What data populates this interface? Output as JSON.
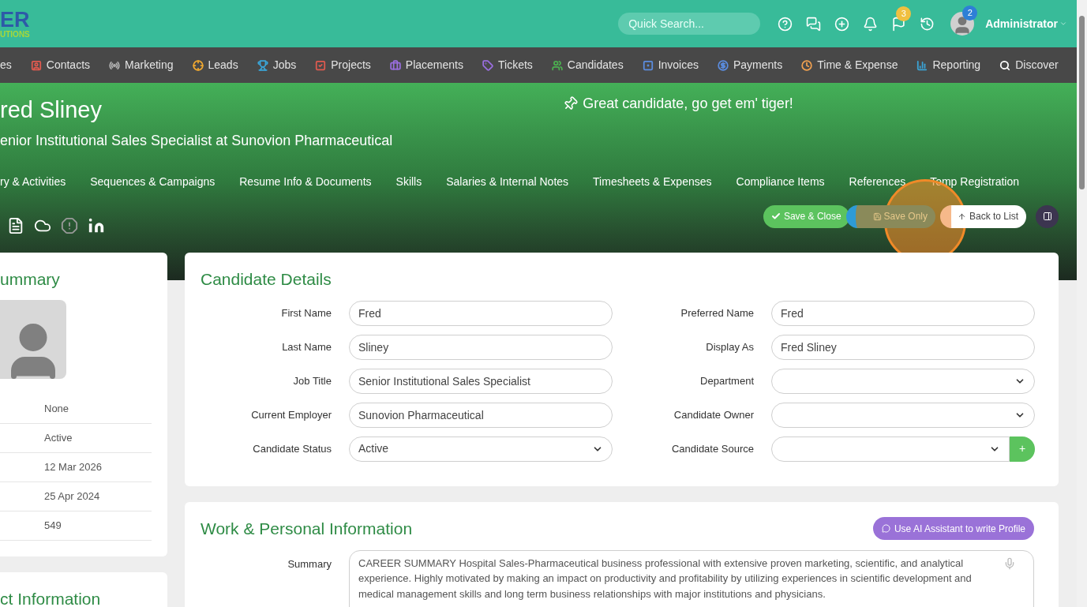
{
  "logo": {
    "text": "ER",
    "subtext": "UTIONS"
  },
  "search": {
    "placeholder": "Quick Search..."
  },
  "header": {
    "flag_badge": "3",
    "avatar_badge": "2",
    "user": "Administrator"
  },
  "nav": [
    {
      "label": "es"
    },
    {
      "label": "Contacts",
      "color": "#e05a4f"
    },
    {
      "label": "Marketing",
      "color": "#b0b0b0"
    },
    {
      "label": "Leads",
      "color": "#f0a830"
    },
    {
      "label": "Jobs",
      "color": "#3aa5d8"
    },
    {
      "label": "Projects",
      "color": "#e05a4f"
    },
    {
      "label": "Placements",
      "color": "#9a6ee0"
    },
    {
      "label": "Tickets",
      "color": "#9a6ee0"
    },
    {
      "label": "Candidates",
      "color": "#4caf50"
    },
    {
      "label": "Invoices",
      "color": "#5b8de0"
    },
    {
      "label": "Payments",
      "color": "#5b8de0"
    },
    {
      "label": "Time & Expense",
      "color": "#f0a050"
    },
    {
      "label": "Reporting",
      "color": "#3aa5d8"
    },
    {
      "label": "Discover",
      "color": "#ffffff"
    }
  ],
  "hero": {
    "name": "red Sliney",
    "subtitle": "enior Institutional Sales Specialist at Sunovion Pharmaceutical",
    "note": "Great candidate, go get em' tiger!"
  },
  "tabs": [
    "ry & Activities",
    "Sequences & Campaigns",
    "Resume Info & Documents",
    "Skills",
    "Salaries & Internal Notes",
    "Timesheets & Expenses",
    "Compliance Items",
    "References",
    "Temp Registration"
  ],
  "actions": [
    {
      "kind": "save_close",
      "label": "Save & Close"
    },
    {
      "kind": "save_only",
      "label": "Save Only"
    },
    {
      "kind": "back",
      "label": "Back to List"
    },
    {
      "kind": "panel"
    }
  ],
  "summary_card": {
    "title": "ummary",
    "values": [
      "None",
      "Active",
      "12 Mar 2026",
      "25 Apr 2024",
      "549"
    ]
  },
  "contact_card": {
    "title": "ct Information"
  },
  "candidate_details": {
    "title": "Candidate Details",
    "rows": [
      {
        "left": {
          "label": "First Name",
          "value": "Fred",
          "kind": "text"
        },
        "right": {
          "label": "Preferred Name",
          "value": "Fred",
          "kind": "text"
        }
      },
      {
        "left": {
          "label": "Last Name",
          "value": "Sliney",
          "kind": "text"
        },
        "right": {
          "label": "Display As",
          "value": "Fred Sliney",
          "kind": "text"
        }
      },
      {
        "left": {
          "label": "Job Title",
          "value": "Senior Institutional Sales Specialist",
          "kind": "text"
        },
        "right": {
          "label": "Department",
          "kind": "select"
        }
      },
      {
        "left": {
          "label": "Current Employer",
          "value": "Sunovion Pharmaceutical",
          "kind": "text"
        },
        "right": {
          "label": "Candidate Owner",
          "kind": "select"
        }
      },
      {
        "left": {
          "label": "Candidate Status",
          "value": "Active",
          "kind": "select"
        },
        "right": {
          "label": "Candidate Source",
          "kind": "select_add",
          "add": "+"
        }
      }
    ]
  },
  "work_info": {
    "title": "Work & Personal Information",
    "ai_button": "Use AI Assistant to write Profile",
    "summary_label": "Summary",
    "summary": "CAREER SUMMARY  Hospital Sales-Pharmaceutical business professional with extensive proven marketing, scientific, and analytical experience. Highly motivated by making an impact on productivity and profitability by utilizing experiences in scientific development and medical management skills and long term business relationships with major institutions and physicians."
  }
}
